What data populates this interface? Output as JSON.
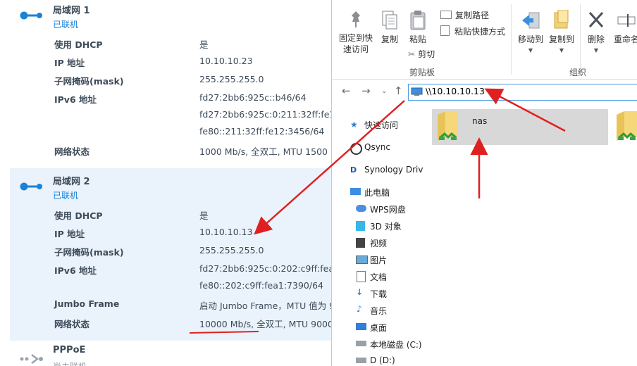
{
  "network": {
    "lan1": {
      "title": "局域网 1",
      "status": "已联机",
      "rows": [
        {
          "label": "使用 DHCP",
          "value": "是"
        },
        {
          "label": "IP 地址",
          "value": "10.10.10.23"
        },
        {
          "label": "子网掩码(mask)",
          "value": "255.255.255.0"
        },
        {
          "label": "IPv6 地址",
          "value": "fd27:2bb6:925c::b46/64"
        },
        {
          "label": "",
          "value": "fd27:2bb6:925c:0:211:32ff:fe1"
        },
        {
          "label": "",
          "value": "fe80::211:32ff:fe12:3456/64"
        },
        {
          "label": "网络状态",
          "value": "1000 Mb/s, 全双工, MTU 1500"
        }
      ]
    },
    "lan2": {
      "title": "局域网 2",
      "status": "已联机",
      "rows": [
        {
          "label": "使用 DHCP",
          "value": "是"
        },
        {
          "label": "IP 地址",
          "value": "10.10.10.13"
        },
        {
          "label": "子网掩码(mask)",
          "value": "255.255.255.0"
        },
        {
          "label": "IPv6 地址",
          "value": "fd27:2bb6:925c:0:202:c9ff:fea"
        },
        {
          "label": "",
          "value": "fe80::202:c9ff:fea1:7390/64"
        },
        {
          "label": "Jumbo Frame",
          "value": "启动 Jumbo Frame，MTU 值为 9"
        },
        {
          "label": "网络状态",
          "value": "10000 Mb/s, 全双工, MTU 9000"
        }
      ]
    },
    "pppoe": {
      "title": "PPPoE",
      "status": "尚未联机"
    }
  },
  "ribbon": {
    "pin_label_1": "固定到快",
    "pin_label_2": "速访问",
    "copy_label": "复制",
    "paste_label": "粘贴",
    "copy_path_label": "复制路径",
    "paste_shortcut_label": "粘贴快捷方式",
    "cut_label": "剪切",
    "move_to_label": "移动到",
    "copy_to_label": "复制到",
    "delete_label": "删除",
    "rename_label": "重命名",
    "group_clipboard": "剪贴板",
    "group_organize": "组织"
  },
  "address": {
    "path": "\\\\10.10.10.13"
  },
  "sidebar": {
    "items": [
      {
        "label": "快速访问",
        "icon": "star-icon"
      },
      {
        "label": "Qsync",
        "icon": "qsync-icon"
      },
      {
        "label": "Synology Driv",
        "icon": "synology-drive-icon"
      },
      {
        "label": "此电脑",
        "icon": "computer-icon"
      },
      {
        "label": "WPS网盘",
        "icon": "cloud-icon"
      },
      {
        "label": "3D 对象",
        "icon": "cube-icon"
      },
      {
        "label": "视频",
        "icon": "video-icon"
      },
      {
        "label": "图片",
        "icon": "picture-icon"
      },
      {
        "label": "文档",
        "icon": "document-icon"
      },
      {
        "label": "下载",
        "icon": "download-icon"
      },
      {
        "label": "音乐",
        "icon": "music-icon"
      },
      {
        "label": "桌面",
        "icon": "desktop-icon"
      },
      {
        "label": "本地磁盘 (C:)",
        "icon": "disk-icon"
      },
      {
        "label": "D (D:)",
        "icon": "disk-icon"
      }
    ]
  },
  "files": [
    {
      "name": "nas"
    }
  ],
  "colors": {
    "accent": "#1a82d7",
    "annotation": "#e02020",
    "highlight": "#eaf3fc"
  }
}
